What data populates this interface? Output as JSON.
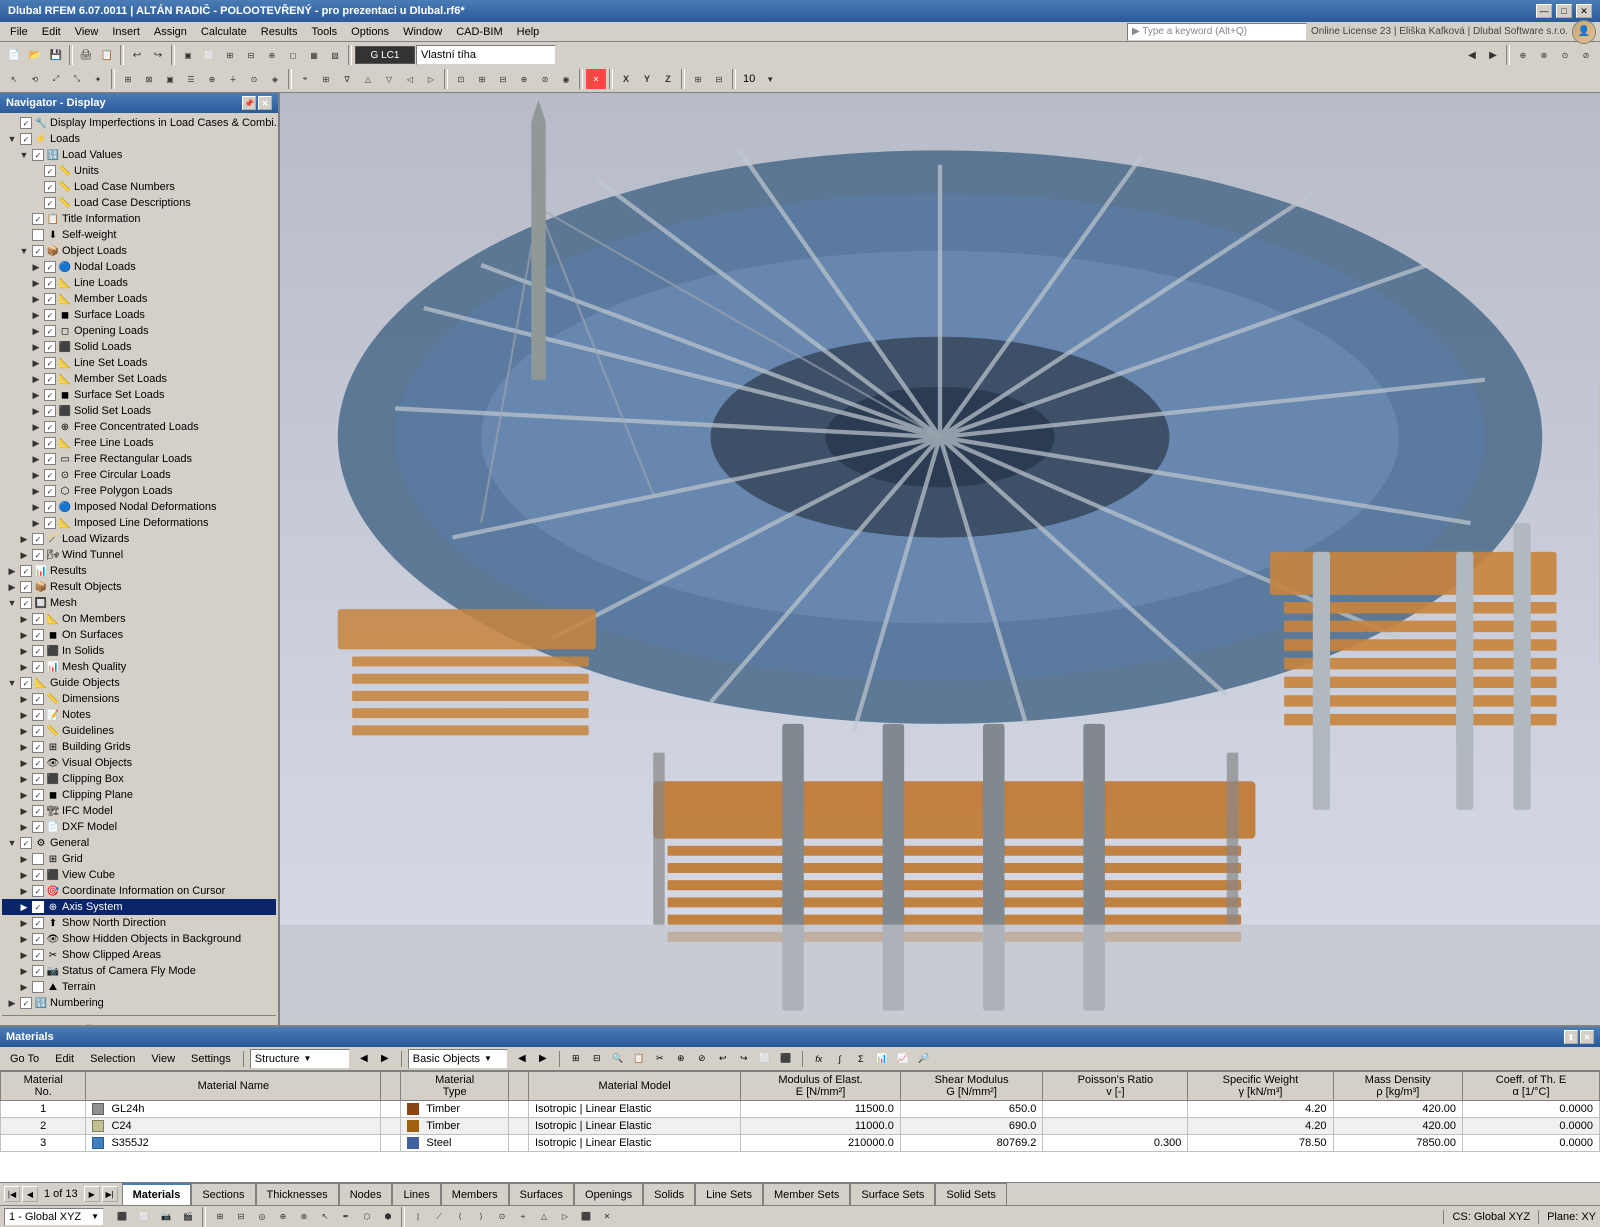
{
  "titleBar": {
    "text": "Dlubal RFEM 6.07.0011 | ALTÁN RADIČ - POLOOTEVŘENÝ - pro prezentaci u Dlubal.rf6*",
    "minBtn": "—",
    "maxBtn": "□",
    "closeBtn": "✕"
  },
  "menuBar": {
    "items": [
      "File",
      "Edit",
      "View",
      "Insert",
      "Assign",
      "Calculate",
      "Results",
      "Tools",
      "Options",
      "Window",
      "CAD-BIM",
      "Help"
    ]
  },
  "toolbar": {
    "loadCase": "LC1",
    "loadCaseName": "Vlastní tíha",
    "searchPlaceholder": "Type a keyword (Alt+Q)"
  },
  "licenseInfo": "Online License 23 | Eliška Kafková | Dlubal Software s.r.o.",
  "navigator": {
    "title": "Navigator - Display",
    "tree": [
      {
        "id": "display-imperfections",
        "label": "Display Imperfections in Load Cases & Combi...",
        "level": 0,
        "checked": true,
        "hasIcon": true
      },
      {
        "id": "loads",
        "label": "Loads",
        "level": 0,
        "expanded": true,
        "checked": true
      },
      {
        "id": "load-values",
        "label": "Load Values",
        "level": 1,
        "expanded": true,
        "checked": true
      },
      {
        "id": "units",
        "label": "Units",
        "level": 2,
        "checked": true
      },
      {
        "id": "load-case-numbers",
        "label": "Load Case Numbers",
        "level": 2,
        "checked": true
      },
      {
        "id": "load-case-descriptions",
        "label": "Load Case Descriptions",
        "level": 2,
        "checked": true
      },
      {
        "id": "title-information",
        "label": "Title Information",
        "level": 1,
        "checked": true
      },
      {
        "id": "self-weight",
        "label": "Self-weight",
        "level": 1,
        "checked": false
      },
      {
        "id": "object-loads",
        "label": "Object Loads",
        "level": 1,
        "expanded": true,
        "checked": true
      },
      {
        "id": "nodal-loads",
        "label": "Nodal Loads",
        "level": 2,
        "checked": true
      },
      {
        "id": "line-loads",
        "label": "Line Loads",
        "level": 2,
        "checked": true
      },
      {
        "id": "member-loads",
        "label": "Member Loads",
        "level": 2,
        "checked": true
      },
      {
        "id": "surface-loads",
        "label": "Surface Loads",
        "level": 2,
        "checked": true
      },
      {
        "id": "opening-loads",
        "label": "Opening Loads",
        "level": 2,
        "checked": true
      },
      {
        "id": "solid-loads",
        "label": "Solid Loads",
        "level": 2,
        "checked": true
      },
      {
        "id": "line-set-loads",
        "label": "Line Set Loads",
        "level": 2,
        "checked": true
      },
      {
        "id": "member-set-loads",
        "label": "Member Set Loads",
        "level": 2,
        "checked": true
      },
      {
        "id": "surface-set-loads",
        "label": "Surface Set Loads",
        "level": 2,
        "checked": true
      },
      {
        "id": "solid-set-loads",
        "label": "Solid Set Loads",
        "level": 2,
        "checked": true
      },
      {
        "id": "free-concentrated-loads",
        "label": "Free Concentrated Loads",
        "level": 2,
        "checked": true
      },
      {
        "id": "free-line-loads",
        "label": "Free Line Loads",
        "level": 2,
        "checked": true
      },
      {
        "id": "free-rectangular-loads",
        "label": "Free Rectangular Loads",
        "level": 2,
        "checked": true
      },
      {
        "id": "free-circular-loads",
        "label": "Free Circular Loads",
        "level": 2,
        "checked": true
      },
      {
        "id": "free-polygon-loads",
        "label": "Free Polygon Loads",
        "level": 2,
        "checked": true
      },
      {
        "id": "imposed-nodal-deformations",
        "label": "Imposed Nodal Deformations",
        "level": 2,
        "checked": true
      },
      {
        "id": "imposed-line-deformations",
        "label": "Imposed Line Deformations",
        "level": 2,
        "checked": true
      },
      {
        "id": "load-wizards",
        "label": "Load Wizards",
        "level": 1,
        "checked": true
      },
      {
        "id": "wind-tunnel",
        "label": "Wind Tunnel",
        "level": 1,
        "checked": true
      },
      {
        "id": "results",
        "label": "Results",
        "level": 0,
        "expanded": false,
        "checked": true
      },
      {
        "id": "result-objects",
        "label": "Result Objects",
        "level": 0,
        "expanded": false,
        "checked": true
      },
      {
        "id": "mesh",
        "label": "Mesh",
        "level": 0,
        "expanded": true,
        "checked": true
      },
      {
        "id": "on-members",
        "label": "On Members",
        "level": 1,
        "checked": true
      },
      {
        "id": "on-surfaces",
        "label": "On Surfaces",
        "level": 1,
        "checked": true
      },
      {
        "id": "in-solids",
        "label": "In Solids",
        "level": 1,
        "checked": true
      },
      {
        "id": "mesh-quality",
        "label": "Mesh Quality",
        "level": 1,
        "checked": true
      },
      {
        "id": "guide-objects",
        "label": "Guide Objects",
        "level": 0,
        "expanded": true,
        "checked": true
      },
      {
        "id": "dimensions",
        "label": "Dimensions",
        "level": 1,
        "checked": true
      },
      {
        "id": "notes",
        "label": "Notes",
        "level": 1,
        "checked": true
      },
      {
        "id": "guidelines",
        "label": "Guidelines",
        "level": 1,
        "checked": true
      },
      {
        "id": "building-grids",
        "label": "Building Grids",
        "level": 1,
        "checked": true
      },
      {
        "id": "visual-objects",
        "label": "Visual Objects",
        "level": 1,
        "checked": true
      },
      {
        "id": "clipping-box",
        "label": "Clipping Box",
        "level": 1,
        "checked": true
      },
      {
        "id": "clipping-plane",
        "label": "Clipping Plane",
        "level": 1,
        "checked": true
      },
      {
        "id": "ifc-model",
        "label": "IFC Model",
        "level": 1,
        "checked": true
      },
      {
        "id": "dxf-model",
        "label": "DXF Model",
        "level": 1,
        "checked": true
      },
      {
        "id": "general",
        "label": "General",
        "level": 0,
        "expanded": true,
        "checked": true
      },
      {
        "id": "grid",
        "label": "Grid",
        "level": 1,
        "checked": false
      },
      {
        "id": "view-cube",
        "label": "View Cube",
        "level": 1,
        "checked": true
      },
      {
        "id": "coordinate-info",
        "label": "Coordinate Information on Cursor",
        "level": 1,
        "checked": true,
        "selected": false
      },
      {
        "id": "axis-system",
        "label": "Axis System",
        "level": 1,
        "checked": true,
        "selected": true
      },
      {
        "id": "show-north",
        "label": "Show North Direction",
        "level": 1,
        "checked": true
      },
      {
        "id": "show-hidden",
        "label": "Show Hidden Objects in Background",
        "level": 1,
        "checked": true
      },
      {
        "id": "show-clipped",
        "label": "Show Clipped Areas",
        "level": 1,
        "checked": true
      },
      {
        "id": "camera-fly",
        "label": "Status of Camera Fly Mode",
        "level": 1,
        "checked": true
      },
      {
        "id": "terrain",
        "label": "Terrain",
        "level": 1,
        "checked": false
      },
      {
        "id": "numbering",
        "label": "Numbering",
        "level": 0,
        "expanded": false,
        "checked": true
      }
    ]
  },
  "bottomPanel": {
    "title": "Materials",
    "menus": [
      "Go To",
      "Edit",
      "Selection",
      "View",
      "Settings"
    ],
    "structureDropdown": "Structure",
    "basicObjectsDropdown": "Basic Objects",
    "tableHeaders": [
      "Material No.",
      "Material Name",
      "",
      "Material Type",
      "",
      "Material Model",
      "Modulus of Elast. E [N/mm²]",
      "Shear Modulus G [N/mm²]",
      "Poisson's Ratio v [-]",
      "Specific Weight γ [kN/m³]",
      "Mass Density ρ [kg/m³]",
      "Coeff. of Th. E α [1/°C]"
    ],
    "rows": [
      {
        "no": 1,
        "name": "GL24h",
        "color": "#a0a0a0",
        "type": "Timber",
        "typeColor": "#8B4513",
        "model": "Isotropic | Linear Elastic",
        "E": "11500.0",
        "G": "650.0",
        "v": "",
        "gamma": "4.20",
        "rho": "420.00",
        "alpha": "0.0000"
      },
      {
        "no": 2,
        "name": "C24",
        "color": "#c0c0a0",
        "type": "Timber",
        "typeColor": "#8B6914",
        "model": "Isotropic | Linear Elastic",
        "E": "11000.0",
        "G": "690.0",
        "v": "",
        "gamma": "4.20",
        "rho": "420.00",
        "alpha": "0.0000"
      },
      {
        "no": 3,
        "name": "S355J2",
        "color": "#4080c0",
        "type": "Steel",
        "typeColor": "#4060a0",
        "model": "Isotropic | Linear Elastic",
        "E": "210000.0",
        "G": "80769.2",
        "v": "0.300",
        "gamma": "78.50",
        "rho": "7850.00",
        "alpha": "0.0000"
      }
    ],
    "pagination": {
      "current": 1,
      "total": 13
    },
    "tabs": [
      "Materials",
      "Sections",
      "Thicknesses",
      "Nodes",
      "Lines",
      "Members",
      "Surfaces",
      "Openings",
      "Solids",
      "Line Sets",
      "Member Sets",
      "Surface Sets",
      "Solid Sets"
    ]
  },
  "statusBar": {
    "viewNumber": "1 - Global XYZ",
    "coordinateSystem": "CS: Global XYZ",
    "plane": "Plane: XY"
  }
}
